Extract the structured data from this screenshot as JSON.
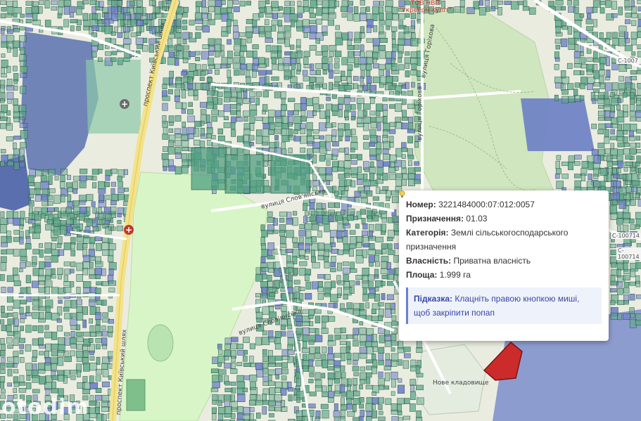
{
  "map": {
    "labels": {
      "avenue_top": "проспект Київський шлях",
      "avenue_bottom": "проспект Київський шлях",
      "company": "ТОВ НВП\n\"Укрвермікуліт\"",
      "street_right": "вулиця Горіхова",
      "street_right2": "вулиця Горіхова",
      "street_mid": "вулиця Слов'янська",
      "street_lower": "вулиця Слов'янська",
      "cemetery": "Нове кладовище",
      "road_c1": "C-1007",
      "road_c2": "C-100714",
      "road_c3": "C-100714"
    },
    "watermark": "otodim",
    "colors": {
      "parcel_green": "#5fa98a",
      "parcel_blue": "#6b7fc9",
      "park": "#cfeacb",
      "highlight": "#cc2b2b",
      "road": "#ffffff",
      "avenue": "#f3e28a"
    }
  },
  "popup": {
    "number_label": "Номер:",
    "number_value": "3221484000:07:012:0057",
    "purpose_label": "Призначення:",
    "purpose_value": "01.03",
    "category_label": "Категорія:",
    "category_value": "Землі сільськогосподарського призначення",
    "ownership_label": "Власність:",
    "ownership_value": "Приватна власність",
    "area_label": "Площа:",
    "area_value": "1.999 га",
    "hint_label": "Підказка:",
    "hint_text": "Клацніть правою кнопкою миші, щоб закріпити попап"
  }
}
